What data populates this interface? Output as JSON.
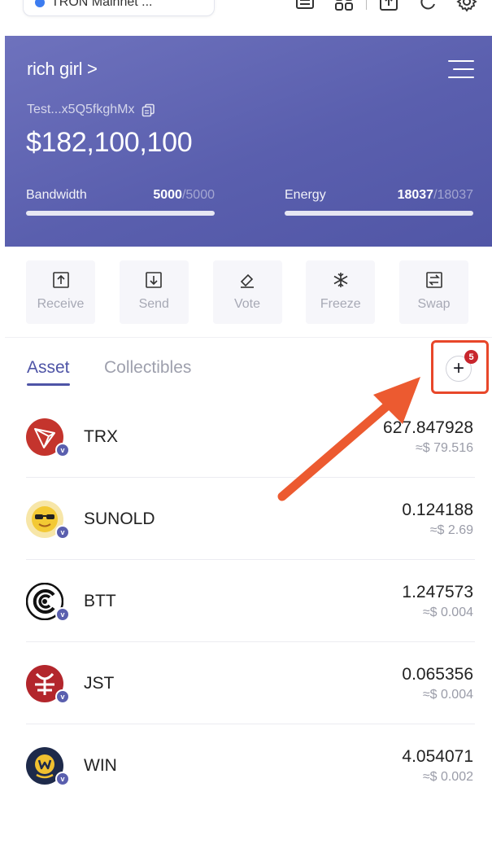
{
  "header": {
    "network_label": "TRON Mainnet ...",
    "icons": [
      "ledger-icon",
      "grid-icon",
      "dapp-icon",
      "refresh-icon",
      "settings-icon"
    ]
  },
  "wallet": {
    "name": "rich girl >",
    "address": "Test...x5Q5fkghMx",
    "balance": "$182,100,100",
    "bandwidth": {
      "label": "Bandwidth",
      "value": "5000",
      "total": "/5000",
      "fraction": 1.0
    },
    "energy": {
      "label": "Energy",
      "value": "18037",
      "total": "/18037",
      "fraction": 1.0
    }
  },
  "actions": [
    {
      "label": "Receive",
      "icon": "receive-icon"
    },
    {
      "label": "Send",
      "icon": "send-icon"
    },
    {
      "label": "Vote",
      "icon": "vote-icon"
    },
    {
      "label": "Freeze",
      "icon": "freeze-icon"
    },
    {
      "label": "Swap",
      "icon": "swap-icon"
    }
  ],
  "tabs": {
    "asset": "Asset",
    "collectibles": "Collectibles"
  },
  "add_token": {
    "label": "+",
    "badge": "5"
  },
  "tokens": [
    {
      "symbol": "TRX",
      "amount": "627.847928",
      "usd": "≈$ 79.516",
      "verified": "v"
    },
    {
      "symbol": "SUNOLD",
      "amount": "0.124188",
      "usd": "≈$ 2.69",
      "verified": "v"
    },
    {
      "symbol": "BTT",
      "amount": "1.247573",
      "usd": "≈$ 0.004",
      "verified": "v"
    },
    {
      "symbol": "JST",
      "amount": "0.065356",
      "usd": "≈$ 0.004",
      "verified": "v"
    },
    {
      "symbol": "WIN",
      "amount": "4.054071",
      "usd": "≈$ 0.002",
      "verified": "v"
    }
  ],
  "colors": {
    "card": "#5a5fae",
    "accent": "#4e54a6",
    "highlight": "#e8472a",
    "badge": "#c8262d"
  }
}
